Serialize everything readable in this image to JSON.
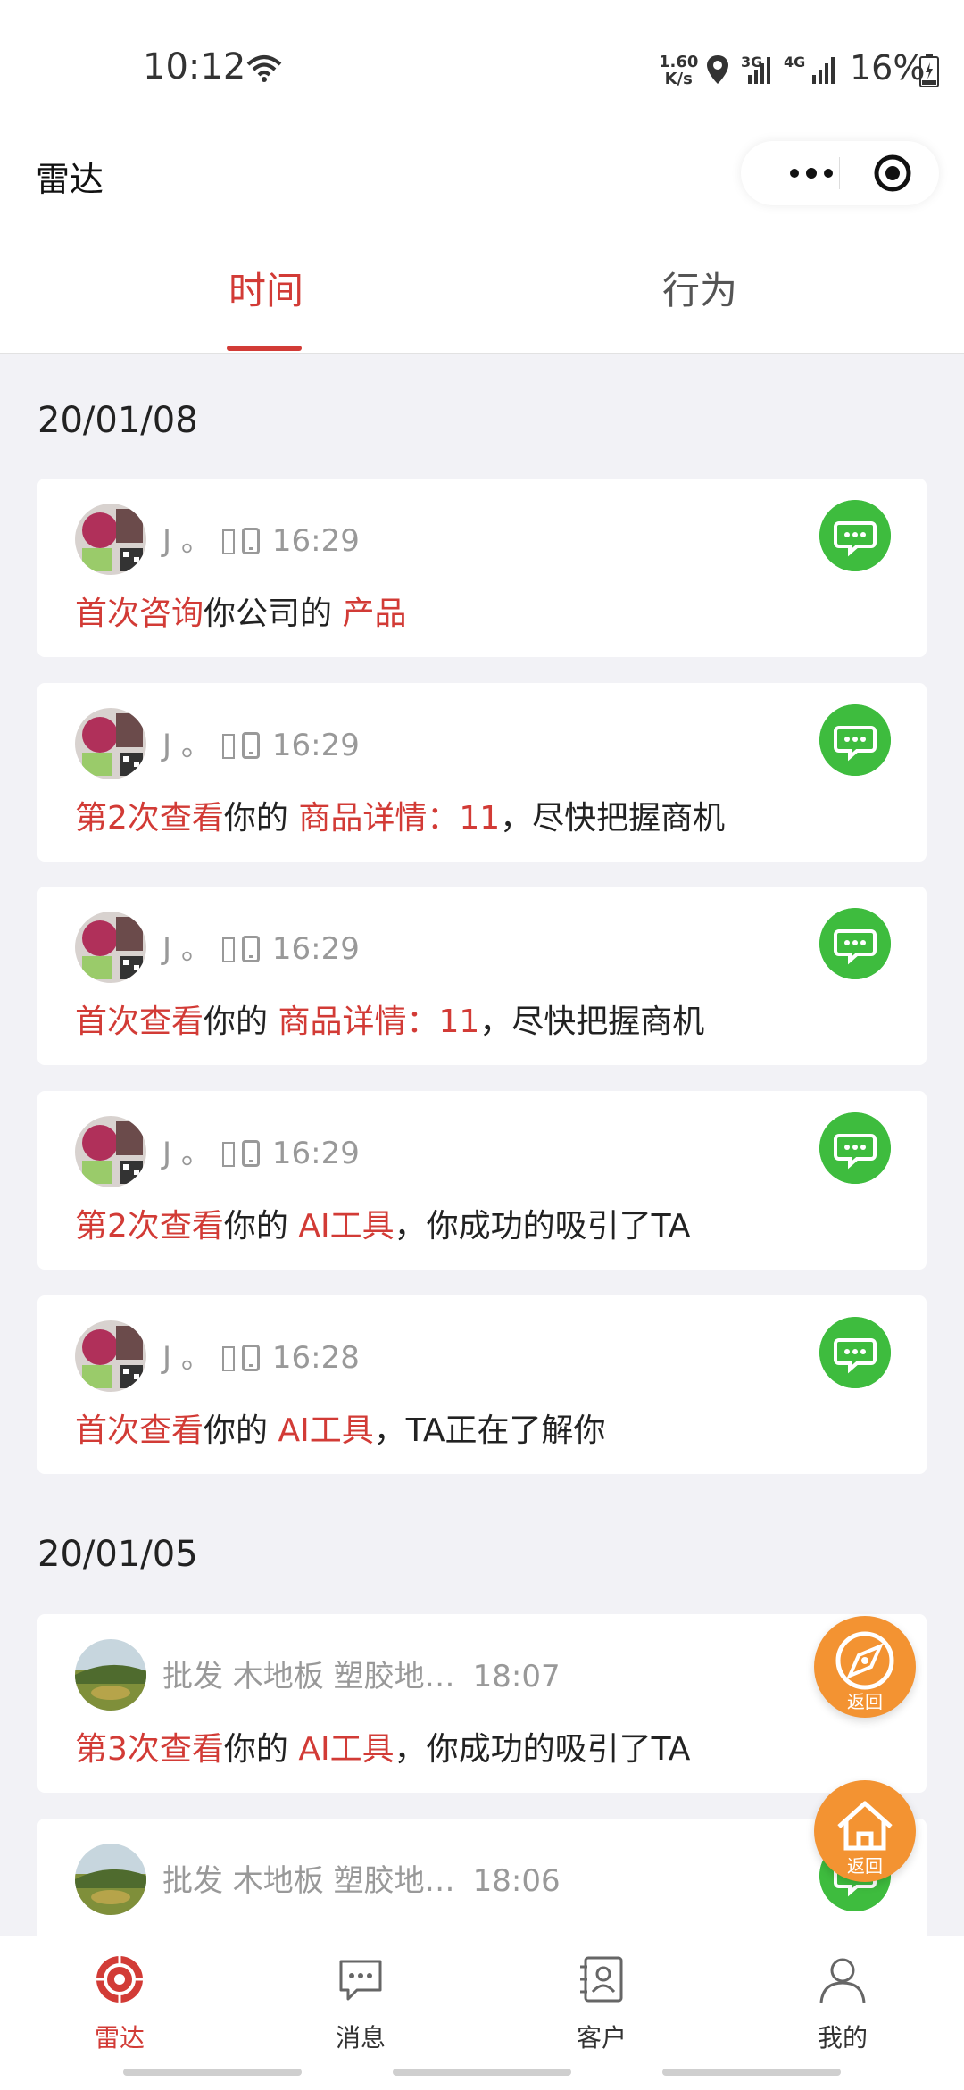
{
  "status_bar": {
    "time": "10:12",
    "net_speed_value": "1.60",
    "net_speed_unit": "K/s",
    "net_type_1": "3G",
    "net_type_2": "4G",
    "battery": "16%"
  },
  "nav": {
    "title": "雷达"
  },
  "tabs": [
    {
      "label": "时间",
      "active": true
    },
    {
      "label": "行为",
      "active": false
    }
  ],
  "groups": [
    {
      "date": "20/01/08",
      "items": [
        {
          "name": "J 。",
          "time": "16:29",
          "action": "首次咨询",
          "mid": "你公司的 ",
          "target": "产品",
          "suffix": ""
        },
        {
          "name": "J 。",
          "time": "16:29",
          "action": "第2次查看",
          "mid": "你的 ",
          "target": "商品详情：11",
          "suffix": "，尽快把握商机"
        },
        {
          "name": "J 。",
          "time": "16:29",
          "action": "首次查看",
          "mid": "你的 ",
          "target": "商品详情：11",
          "suffix": "，尽快把握商机"
        },
        {
          "name": "J 。",
          "time": "16:29",
          "action": "第2次查看",
          "mid": "你的 ",
          "target": "AI工具",
          "suffix": "，你成功的吸引了TA"
        },
        {
          "name": "J 。",
          "time": "16:28",
          "action": "首次查看",
          "mid": "你的 ",
          "target": "AI工具",
          "suffix": "，TA正在了解你"
        }
      ]
    },
    {
      "date": "20/01/05",
      "items": [
        {
          "name": "批发 木地板 塑胶地…",
          "time": "18:07",
          "action": "第3次查看",
          "mid": "你的 ",
          "target": "AI工具",
          "suffix": "，你成功的吸引了TA"
        },
        {
          "name": "批发 木地板 塑胶地…",
          "time": "18:06",
          "action": "",
          "mid": "",
          "target": "",
          "suffix": ""
        }
      ]
    }
  ],
  "fabs": [
    {
      "label": "返回",
      "icon": "compass-icon"
    },
    {
      "label": "返回",
      "icon": "home-icon"
    }
  ],
  "bottom_nav": [
    {
      "label": "雷达",
      "icon": "radar-icon",
      "active": true
    },
    {
      "label": "消息",
      "icon": "message-icon",
      "active": false
    },
    {
      "label": "客户",
      "icon": "contacts-icon",
      "active": false
    },
    {
      "label": "我的",
      "icon": "person-icon",
      "active": false
    }
  ],
  "colors": {
    "accent": "#d23b36",
    "chat_green": "#3ebc3e",
    "fab_orange": "#f39332"
  }
}
